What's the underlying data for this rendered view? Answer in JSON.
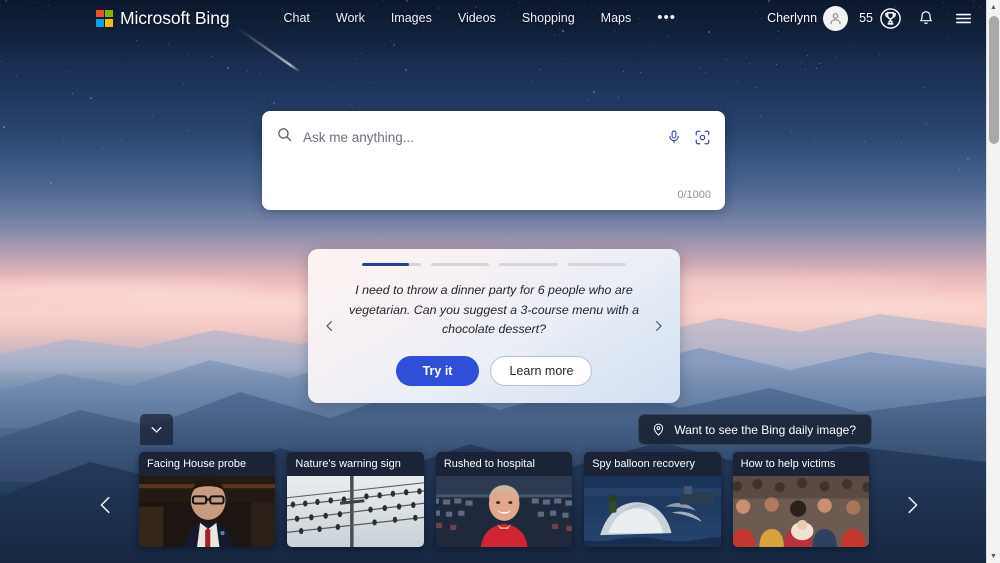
{
  "header": {
    "brand": "Microsoft Bing",
    "logo_icon": "microsoft-logo-icon",
    "nav": [
      {
        "label": "Chat"
      },
      {
        "label": "Work"
      },
      {
        "label": "Images"
      },
      {
        "label": "Videos"
      },
      {
        "label": "Shopping"
      },
      {
        "label": "Maps"
      }
    ],
    "more_label": "•••",
    "user_name": "Cherlynn",
    "avatar_icon": "person-avatar-icon",
    "rewards_count": "55",
    "rewards_icon": "trophy-icon",
    "notifications_icon": "bell-icon",
    "menu_icon": "hamburger-menu-icon"
  },
  "search": {
    "placeholder": "Ask me anything...",
    "value": "",
    "char_count": "0/1000",
    "search_icon": "search-icon",
    "mic_icon": "microphone-icon",
    "lens_icon": "visual-search-camera-icon"
  },
  "suggestion_card": {
    "progress": [
      80,
      0,
      0,
      0
    ],
    "prompt": "I need to throw a dinner party for 6 people who are vegetarian. Can you suggest a 3-course menu with a chocolate dessert?",
    "try_label": "Try it",
    "learn_label": "Learn more",
    "prev_icon": "chevron-left-icon",
    "next_icon": "chevron-right-icon"
  },
  "daily_image": {
    "label": "Want to see the Bing daily image?",
    "icon": "location-pin-icon"
  },
  "expand": {
    "icon": "chevron-down-icon"
  },
  "news": {
    "prev_icon": "chevron-left-icon",
    "next_icon": "chevron-right-icon",
    "cards": [
      {
        "title": "Facing House probe",
        "thumb": "man-in-suit-at-hearing"
      },
      {
        "title": "Nature's warning sign",
        "thumb": "birds-on-power-lines"
      },
      {
        "title": "Rushed to hospital",
        "thumb": "man-red-shirt-stadium"
      },
      {
        "title": "Spy balloon recovery",
        "thumb": "balloon-debris-on-water"
      },
      {
        "title": "How to help victims",
        "thumb": "crowd-of-people"
      }
    ]
  },
  "colors": {
    "accent_blue": "#2f4fd8",
    "progress_blue": "#2b3aa8",
    "sky_top": "#152745",
    "sunset_pink": "#fbd2cb",
    "news_card_bg": "#1a2436"
  },
  "scrollbar": {
    "up_icon": "scroll-up-arrow-icon",
    "down_icon": "scroll-down-arrow-icon"
  }
}
